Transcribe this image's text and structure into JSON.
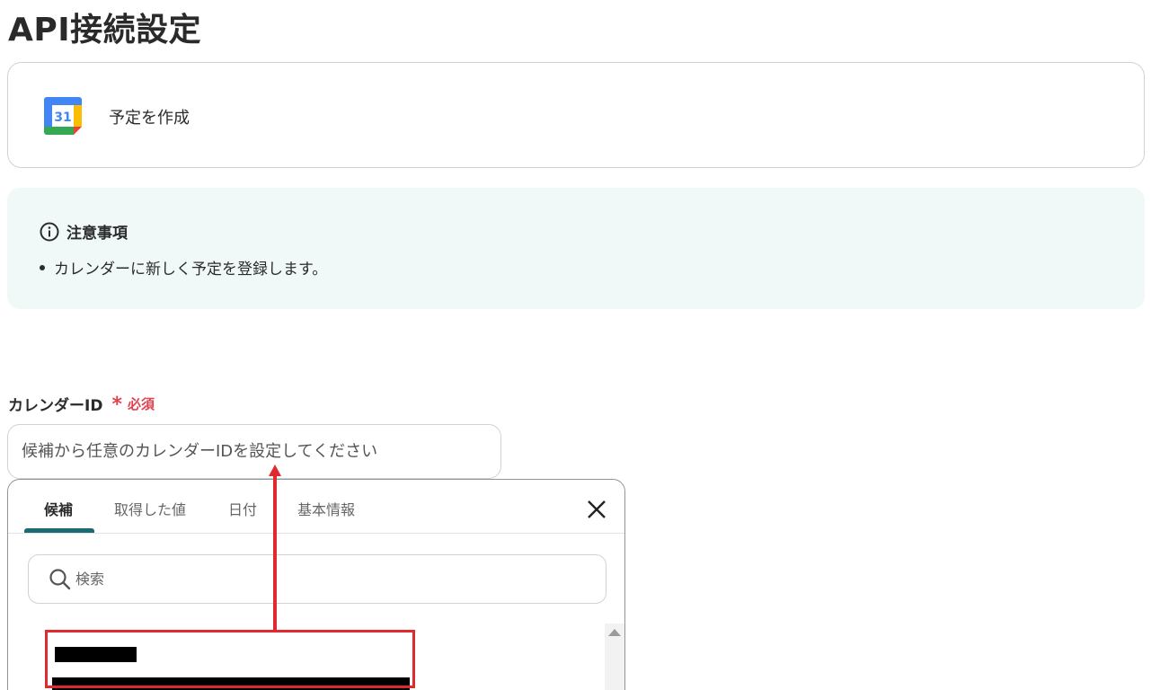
{
  "page": {
    "title": "API接続設定"
  },
  "action": {
    "label": "予定を作成",
    "icon": "google-calendar-icon",
    "icon_day": "31"
  },
  "notice": {
    "title": "注意事項",
    "icon": "info-icon",
    "items": [
      "カレンダーに新しく予定を登録します。"
    ]
  },
  "field": {
    "label": "カレンダーID",
    "required_mark": "*",
    "required_text": "必須",
    "placeholder": "候補から任意のカレンダーIDを設定してください",
    "value": ""
  },
  "dropdown": {
    "tabs": [
      {
        "label": "候補",
        "active": true
      },
      {
        "label": "取得した値",
        "active": false
      },
      {
        "label": "日付",
        "active": false
      },
      {
        "label": "基本情報",
        "active": false
      }
    ],
    "close_icon": "close-icon",
    "search_placeholder": "検索",
    "search_icon": "search-icon"
  },
  "colors": {
    "accent": "#1b6b73",
    "required": "#e0424e",
    "annotation": "#e02a2f",
    "notice_bg": "#f1f9f8"
  }
}
